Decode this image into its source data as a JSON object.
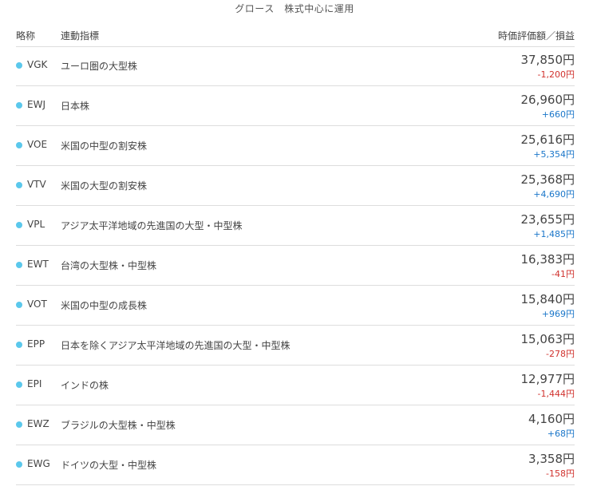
{
  "title": "グロース　株式中心に運用",
  "header": {
    "abbr": "略称",
    "index": "連動指標",
    "value": "時価評価額／損益"
  },
  "colors": {
    "dot": "#5bc8ec",
    "loss": "#d0312d",
    "gain": "#1a76c9"
  },
  "rows": [
    {
      "ticker": "VGK",
      "index": "ユーロ圏の大型株",
      "value": "37,850円",
      "pl": "-1,200円",
      "pl_sign": "neg"
    },
    {
      "ticker": "EWJ",
      "index": "日本株",
      "value": "26,960円",
      "pl": "+660円",
      "pl_sign": "pos"
    },
    {
      "ticker": "VOE",
      "index": "米国の中型の割安株",
      "value": "25,616円",
      "pl": "+5,354円",
      "pl_sign": "pos"
    },
    {
      "ticker": "VTV",
      "index": "米国の大型の割安株",
      "value": "25,368円",
      "pl": "+4,690円",
      "pl_sign": "pos"
    },
    {
      "ticker": "VPL",
      "index": "アジア太平洋地域の先進国の大型・中型株",
      "value": "23,655円",
      "pl": "+1,485円",
      "pl_sign": "pos"
    },
    {
      "ticker": "EWT",
      "index": "台湾の大型株・中型株",
      "value": "16,383円",
      "pl": "-41円",
      "pl_sign": "neg"
    },
    {
      "ticker": "VOT",
      "index": "米国の中型の成長株",
      "value": "15,840円",
      "pl": "+969円",
      "pl_sign": "pos"
    },
    {
      "ticker": "EPP",
      "index": "日本を除くアジア太平洋地域の先進国の大型・中型株",
      "value": "15,063円",
      "pl": "-278円",
      "pl_sign": "neg"
    },
    {
      "ticker": "EPI",
      "index": "インドの株",
      "value": "12,977円",
      "pl": "-1,444円",
      "pl_sign": "neg"
    },
    {
      "ticker": "EWZ",
      "index": "ブラジルの大型株・中型株",
      "value": "4,160円",
      "pl": "+68円",
      "pl_sign": "pos"
    },
    {
      "ticker": "EWG",
      "index": "ドイツの大型・中型株",
      "value": "3,358円",
      "pl": "-158円",
      "pl_sign": "neg"
    }
  ]
}
